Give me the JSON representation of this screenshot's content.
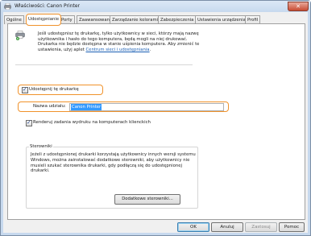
{
  "window": {
    "title": "Właściwości: Canon Printer",
    "close_glyph": "✕"
  },
  "tabs": [
    {
      "label": "Ogólne"
    },
    {
      "label": "Udostępnianie"
    },
    {
      "label": "Porty"
    },
    {
      "label": "Zaawansowane"
    },
    {
      "label": "Zarządzanie kolorami"
    },
    {
      "label": "Zabezpieczenia"
    },
    {
      "label": "Ustawienia urządzenia"
    },
    {
      "label": "Profil"
    }
  ],
  "sharing": {
    "info_text": "Jeśli udostępnisz tę drukarkę, tylko użytkownicy w sieci, którzy mają nazwę użytkownika i hasło do tego komputera, będą mogli na niej drukować. Drukarka nie będzie dostępna w stanie uśpienia komputera. Aby zmienić te ustawienia, użyj aplet",
    "info_link": "Centrum sieci i udostępniania",
    "info_end": ".",
    "share_checkbox_label": "Udostępnij tę drukarkę",
    "share_checked": true,
    "share_name_label": "Nazwa udziału:",
    "share_name_value": "Canon Printer",
    "render_checkbox_label": "Renderuj zadania wydruku na komputerach klienckich",
    "render_checked": true
  },
  "drivers": {
    "group_title": "Sterowniki",
    "text": "Jeżeli z udostępnionej drukarki korzystają użytkownicy innych wersji systemu Windows, można zainstalować dodatkowe sterowniki, aby użytkownicy nie musieli szukać sterownika drukarki, gdy podłączą się do udostępnionej drukarki.",
    "button_label": "Dodatkowe sterowniki..."
  },
  "footer": {
    "ok": "OK",
    "cancel": "Anuluj",
    "apply": "Zastosuj",
    "help": "Pomoc"
  },
  "icons": {
    "window": "printer-icon",
    "share": "shared-printer-icon",
    "check": "✓"
  },
  "colors": {
    "highlight": "#f0922b",
    "selection": "#3399ff",
    "link": "#1a5fb4"
  }
}
